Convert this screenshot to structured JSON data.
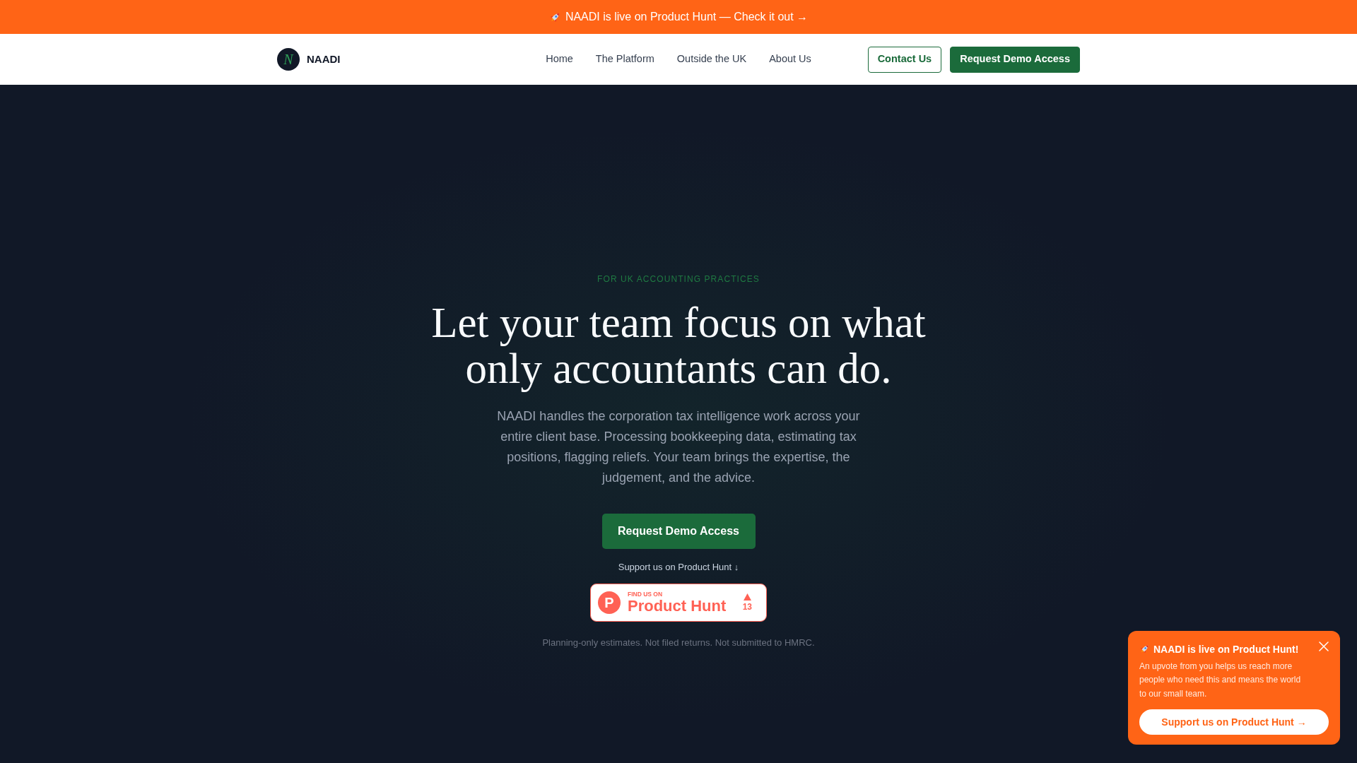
{
  "announcement_bar": {
    "text": "NAADI is live on Product Hunt — Check it out →"
  },
  "nav": {
    "logo": {
      "mark": "N",
      "name": "NAADI"
    },
    "links": [
      {
        "label": "Home"
      },
      {
        "label": "The Platform"
      },
      {
        "label": "Outside the UK"
      },
      {
        "label": "About Us"
      }
    ],
    "buttons": [
      {
        "label": "Contact Us",
        "kind": "outline"
      },
      {
        "label": "Request Demo Access",
        "kind": "solid"
      }
    ]
  },
  "hero": {
    "eyebrow": "FOR UK ACCOUNTING PRACTICES",
    "heading": "Let your team focus on what only accountants can do.",
    "description": "NAADI handles the corporation tax intelligence work across your entire client base. Processing bookkeeping data, estimating tax positions, flagging reliefs. Your team brings the expertise, the judgement, and the advice.",
    "cta": "Request Demo Access",
    "support_text": "Support us on Product Hunt ↓",
    "badge": {
      "logo_letter": "P",
      "kicker": "FIND US ON",
      "name": "Product Hunt",
      "votes": "13"
    },
    "disclaimer": "Planning-only estimates. Not filed returns. Not submitted to HMRC."
  },
  "popup": {
    "title": "NAADI is live on Product Hunt!",
    "body": "An upvote from you helps us reach more people who need this and means the world to our small team.",
    "button": "Support us on Product Hunt →"
  }
}
